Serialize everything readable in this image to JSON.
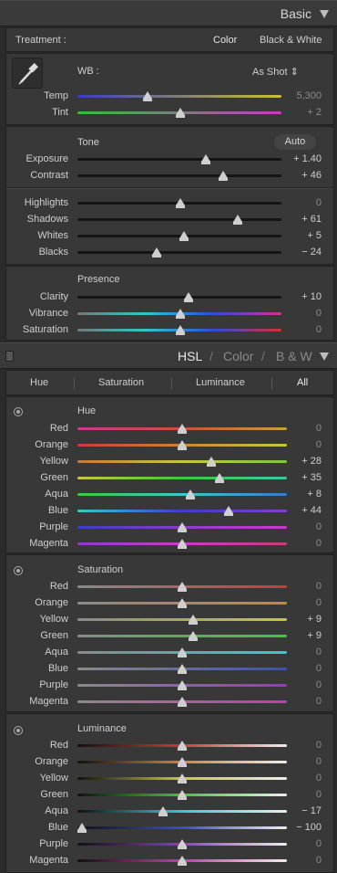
{
  "basic": {
    "title": "Basic",
    "treatment_label": "Treatment :",
    "treatment_color": "Color",
    "treatment_bw": "Black & White",
    "wb_label": "WB :",
    "wb_value": "As Shot",
    "wb_arrows": "⇕",
    "temp": {
      "label": "Temp",
      "value": "5,300",
      "position": 0.34
    },
    "tint": {
      "label": "Tint",
      "value": "+ 2",
      "position": 0.5
    },
    "tone_label": "Tone",
    "auto_label": "Auto",
    "exposure": {
      "label": "Exposure",
      "value": "+ 1.40",
      "position": 0.63
    },
    "contrast": {
      "label": "Contrast",
      "value": "+ 46",
      "position": 0.72
    },
    "highlights": {
      "label": "Highlights",
      "value": "0",
      "position": 0.5
    },
    "shadows": {
      "label": "Shadows",
      "value": "+ 61",
      "position": 0.79
    },
    "whites": {
      "label": "Whites",
      "value": "+ 5",
      "position": 0.52
    },
    "blacks": {
      "label": "Blacks",
      "value": "− 24",
      "position": 0.38
    },
    "presence_label": "Presence",
    "clarity": {
      "label": "Clarity",
      "value": "+ 10",
      "position": 0.55
    },
    "vibrance": {
      "label": "Vibrance",
      "value": "0",
      "position": 0.5
    },
    "saturation": {
      "label": "Saturation",
      "value": "0",
      "position": 0.5
    }
  },
  "hsl": {
    "header_hsl": "HSL",
    "header_slash1": "/",
    "header_color": "Color",
    "header_slash2": "/",
    "header_bw": "B & W",
    "tabs": {
      "hue": "Hue",
      "saturation": "Saturation",
      "luminance": "Luminance",
      "all": "All"
    },
    "hue_section": {
      "title": "Hue",
      "rows": [
        {
          "label": "Red",
          "value": "0"
        },
        {
          "label": "Orange",
          "value": "0"
        },
        {
          "label": "Yellow",
          "value": "+ 28"
        },
        {
          "label": "Green",
          "value": "+ 35"
        },
        {
          "label": "Aqua",
          "value": "+ 8"
        },
        {
          "label": "Blue",
          "value": "+ 44"
        },
        {
          "label": "Purple",
          "value": "0"
        },
        {
          "label": "Magenta",
          "value": "0"
        }
      ]
    },
    "saturation_section": {
      "title": "Saturation",
      "rows": [
        {
          "label": "Red",
          "value": "0"
        },
        {
          "label": "Orange",
          "value": "0"
        },
        {
          "label": "Yellow",
          "value": "+ 9"
        },
        {
          "label": "Green",
          "value": "+ 9"
        },
        {
          "label": "Aqua",
          "value": "0"
        },
        {
          "label": "Blue",
          "value": "0"
        },
        {
          "label": "Purple",
          "value": "0"
        },
        {
          "label": "Magenta",
          "value": "0"
        }
      ]
    },
    "luminance_section": {
      "title": "Luminance",
      "rows": [
        {
          "label": "Red",
          "value": "0"
        },
        {
          "label": "Orange",
          "value": "0"
        },
        {
          "label": "Yellow",
          "value": "0"
        },
        {
          "label": "Green",
          "value": "0"
        },
        {
          "label": "Aqua",
          "value": "− 17"
        },
        {
          "label": "Blue",
          "value": "− 100"
        },
        {
          "label": "Purple",
          "value": "0"
        },
        {
          "label": "Magenta",
          "value": "0"
        }
      ]
    },
    "hue_positions": [
      0.5,
      0.5,
      0.64,
      0.68,
      0.54,
      0.72,
      0.5,
      0.5
    ],
    "sat_positions": [
      0.5,
      0.5,
      0.55,
      0.55,
      0.5,
      0.5,
      0.5,
      0.5
    ],
    "lum_positions": [
      0.5,
      0.5,
      0.5,
      0.5,
      0.41,
      0.02,
      0.5,
      0.5
    ]
  },
  "icons": {
    "eyedropper": "eyedropper-icon",
    "collapse": "triangle-down-icon",
    "target": "target-adjust-icon"
  },
  "colors": {
    "accent": "#cfcfcf",
    "panel": "#383838",
    "background": "#2b2b2b"
  }
}
